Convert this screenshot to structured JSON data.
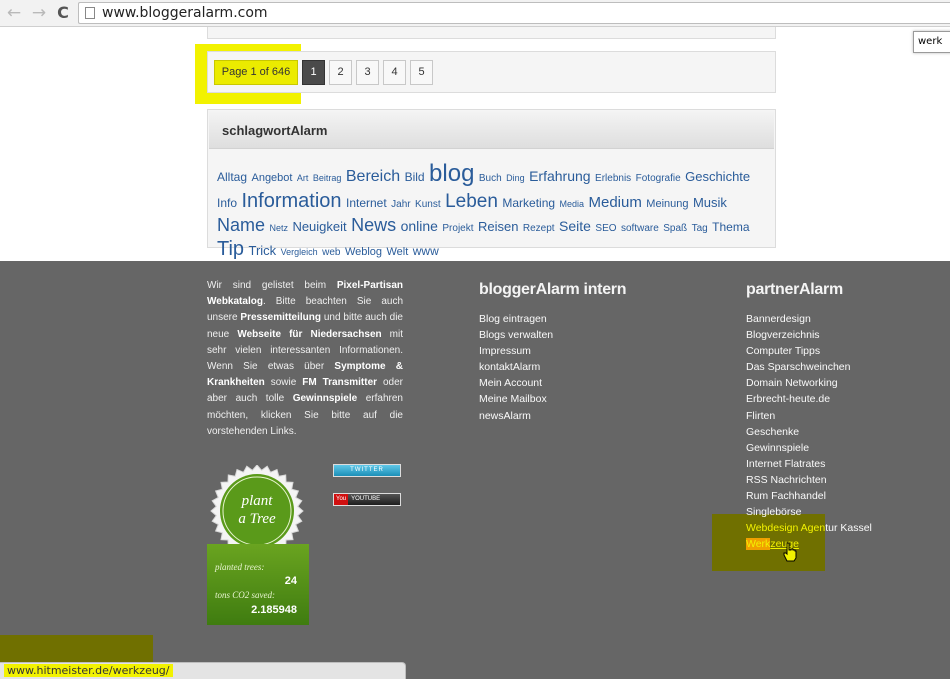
{
  "browser": {
    "back_glyph": "←",
    "forward_glyph": "→",
    "reload_glyph": "C",
    "url": "www.bloggeralarm.com",
    "find_text": "werk"
  },
  "pagination": {
    "info": "Page 1 of 646",
    "pages": [
      "1",
      "2",
      "3",
      "4",
      "5"
    ],
    "active_page": "1"
  },
  "tags": {
    "title": "schlagwortAlarm",
    "items": [
      {
        "text": "Alltag",
        "size": 12
      },
      {
        "text": "Angebot",
        "size": 11
      },
      {
        "text": "Art",
        "size": 9
      },
      {
        "text": "Beitrag",
        "size": 9
      },
      {
        "text": "Bereich",
        "size": 16
      },
      {
        "text": "Bild",
        "size": 12
      },
      {
        "text": "blog",
        "size": 24
      },
      {
        "text": "Buch",
        "size": 10
      },
      {
        "text": "Ding",
        "size": 9
      },
      {
        "text": "Erfahrung",
        "size": 14
      },
      {
        "text": "Erlebnis",
        "size": 10
      },
      {
        "text": "Fotografie",
        "size": 10
      },
      {
        "text": "Geschichte",
        "size": 13
      },
      {
        "text": "Info",
        "size": 12
      },
      {
        "text": "Information",
        "size": 20
      },
      {
        "text": "Internet",
        "size": 12
      },
      {
        "text": "Jahr",
        "size": 10
      },
      {
        "text": "Kunst",
        "size": 10
      },
      {
        "text": "Leben",
        "size": 19
      },
      {
        "text": "Marketing",
        "size": 12
      },
      {
        "text": "Media",
        "size": 9
      },
      {
        "text": "Medium",
        "size": 15
      },
      {
        "text": "Meinung",
        "size": 11
      },
      {
        "text": "Musik",
        "size": 13
      },
      {
        "text": "Name",
        "size": 18
      },
      {
        "text": "Netz",
        "size": 9
      },
      {
        "text": "Neuigkeit",
        "size": 13
      },
      {
        "text": "News",
        "size": 18
      },
      {
        "text": "online",
        "size": 14
      },
      {
        "text": "Projekt",
        "size": 10
      },
      {
        "text": "Reisen",
        "size": 13
      },
      {
        "text": "Rezept",
        "size": 10
      },
      {
        "text": "Seite",
        "size": 14
      },
      {
        "text": "SEO",
        "size": 10
      },
      {
        "text": "software",
        "size": 10
      },
      {
        "text": "Spaß",
        "size": 10
      },
      {
        "text": "Tag",
        "size": 10
      },
      {
        "text": "Thema",
        "size": 12
      },
      {
        "text": "Tip",
        "size": 20
      },
      {
        "text": "Trick",
        "size": 13
      },
      {
        "text": "Vergleich",
        "size": 9
      },
      {
        "text": "web",
        "size": 10
      },
      {
        "text": "Weblog",
        "size": 11
      },
      {
        "text": "Welt",
        "size": 11
      },
      {
        "text": "www",
        "size": 12
      }
    ]
  },
  "about": {
    "t1": "Wir sind gelistet beim ",
    "b1": "Pixel-Partisan Webkatalog",
    "t2": ". Bitte beachten Sie auch unsere ",
    "b2": "Pressemitteilung",
    "t3": " und bitte auch die neue ",
    "b3": "Webseite für Niedersachsen",
    "t4": " mit sehr vielen interessanten Informationen. Wenn Sie etwas über ",
    "b4": "Symptome & Krankheiten",
    "t5": " sowie ",
    "b5": "FM Transmitter",
    "t6": " oder aber auch tolle ",
    "b6": "Gewinnspiele",
    "t7": " erfahren möchten, klicken Sie bitte auf die vorstehenden Links."
  },
  "badges": {
    "twitter": "TWITTER",
    "youtube_logo": "You",
    "youtube": "YOUTUBE"
  },
  "trees": {
    "seal_line1": "plant",
    "seal_line2": "a Tree",
    "planted_label": "planted trees:",
    "planted_value": "24",
    "co2_label": "tons CO2 saved:",
    "co2_value": "2.185948"
  },
  "intern": {
    "title": "bloggerAlarm intern",
    "links": [
      "Blog eintragen",
      "Blogs verwalten",
      "Impressum",
      "kontaktAlarm",
      "Mein Account",
      "Meine Mailbox",
      "newsAlarm"
    ]
  },
  "partner": {
    "title": "partnerAlarm",
    "links": [
      "Bannerdesign",
      "Blogverzeichnis",
      "Computer Tipps",
      "Das Sparschweinchen",
      "Domain Networking",
      "Erbrecht-heute.de",
      "Flirten",
      "Geschenke",
      "Gewinnspiele",
      "Internet Flatrates",
      "RSS Nachrichten",
      "Rum Fachhandel",
      "Singlebörse"
    ],
    "webdesign_a": "Webdesign Agen",
    "webdesign_b": "tur Kassel",
    "werkzeuge_a": "Werk",
    "werkzeuge_b": "zeuge"
  },
  "status": {
    "url": "www.hitmeister.de/werkzeug/"
  },
  "colors": {
    "highlight": "#f2f200",
    "footer_bg": "#666666",
    "tag_blue": "#2a5c9a"
  }
}
